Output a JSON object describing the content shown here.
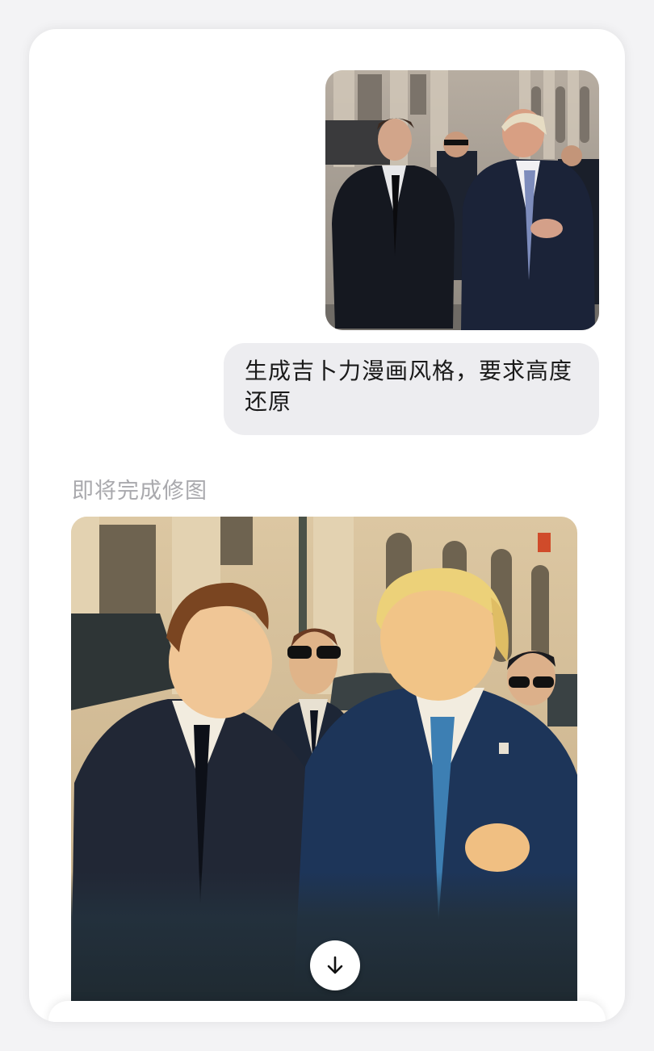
{
  "chat": {
    "user_message": "生成吉卜力漫画风格，要求高度还原",
    "status_text": "即将完成修图"
  },
  "icons": {
    "download": "arrow-down-icon"
  },
  "colors": {
    "bubble_bg": "#ededf0",
    "status_text": "#a9a9ad",
    "card_bg": "#ffffff"
  }
}
